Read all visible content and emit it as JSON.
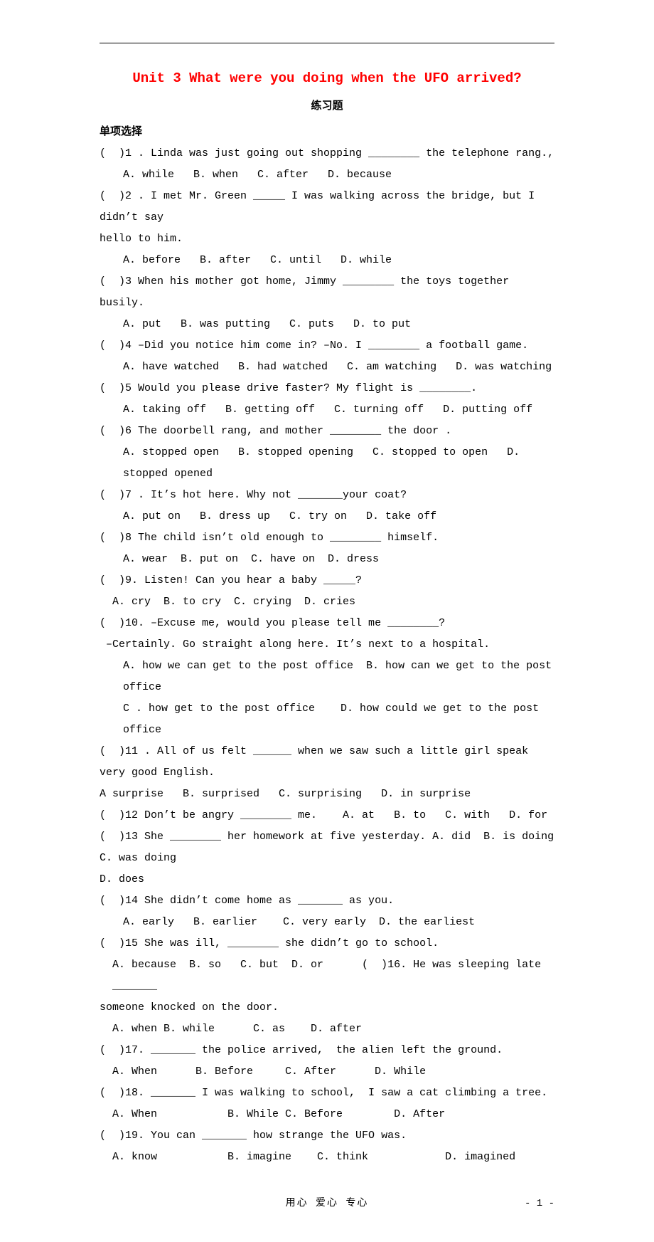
{
  "title": "Unit 3 What were you doing when the UFO arrived?",
  "subtitle": "练习题",
  "section": "单项选择",
  "lines": [
    {
      "cls": "q",
      "t": "(  )1 . Linda was just going out shopping ________ the telephone rang.,"
    },
    {
      "cls": "opt ind",
      "t": "A. while   B. when   C. after   D. because"
    },
    {
      "cls": "q",
      "t": "(  )2 . I met Mr. Green _____ I was walking across the bridge, but I didn’t say"
    },
    {
      "cls": "q",
      "t": "hello to him."
    },
    {
      "cls": "opt ind",
      "t": "A. before   B. after   C. until   D. while"
    },
    {
      "cls": "q",
      "t": "(  )3 When his mother got home, Jimmy ________ the toys together busily."
    },
    {
      "cls": "opt ind",
      "t": "A. put   B. was putting   C. puts   D. to put"
    },
    {
      "cls": "q",
      "t": "(  )4 –Did you notice him come in? –No. I ________ a football game."
    },
    {
      "cls": "opt ind",
      "t": "A. have watched   B. had watched   C. am watching   D. was watching"
    },
    {
      "cls": "q",
      "t": "(  )5 Would you please drive faster? My flight is ________."
    },
    {
      "cls": "opt ind",
      "t": "A. taking off   B. getting off   C. turning off   D. putting off"
    },
    {
      "cls": "q",
      "t": "(  )6 The doorbell rang, and mother ________ the door ."
    },
    {
      "cls": "opt ind",
      "t": "A. stopped open   B. stopped opening   C. stopped to open   D. stopped opened"
    },
    {
      "cls": "q",
      "t": "(  )7 . It’s hot here. Why not _______your coat?"
    },
    {
      "cls": "opt ind",
      "t": "A. put on   B. dress up   C. try on   D. take off"
    },
    {
      "cls": "q",
      "t": "(  )8 The child isn’t old enough to ________ himself."
    },
    {
      "cls": "opt ind",
      "t": "A. wear  B. put on  C. have on  D. dress"
    },
    {
      "cls": "q",
      "t": "(  )9. Listen! Can you hear a baby _____?"
    },
    {
      "cls": "opt ind1",
      "t": "A. cry  B. to cry  C. crying  D. cries"
    },
    {
      "cls": "q",
      "t": "(  )10. –Excuse me, would you please tell me ________?"
    },
    {
      "cls": "q",
      "t": " –Certainly. Go straight along here. It’s next to a hospital."
    },
    {
      "cls": "opt ind",
      "t": "A. how we can get to the post office  B. how can we get to the post office"
    },
    {
      "cls": "opt ind",
      "t": "C . how get to the post office    D. how could we get to the post office"
    },
    {
      "cls": "q",
      "t": "(  )11 . All of us felt ______ when we saw such a little girl speak very good English."
    },
    {
      "cls": "q",
      "t": "A surprise   B. surprised   C. surprising   D. in surprise"
    },
    {
      "cls": "q",
      "t": "(  )12 Don’t be angry ________ me.    A. at   B. to   C. with   D. for"
    },
    {
      "cls": "q",
      "t": "(  )13 She ________ her homework at five yesterday. A. did  B. is doing  C. was doing"
    },
    {
      "cls": "q",
      "t": "D. does"
    },
    {
      "cls": "q",
      "t": "(  )14 She didn’t come home as _______ as you."
    },
    {
      "cls": "opt ind",
      "t": "A. early   B. earlier    C. very early  D. the earliest"
    },
    {
      "cls": "q",
      "t": "(  )15 She was ill, ________ she didn’t go to school."
    },
    {
      "cls": "opt ind1",
      "t": "A. because  B. so   C. but  D. or      (  )16. He was sleeping late _______"
    },
    {
      "cls": "q",
      "t": "someone knocked on the door."
    },
    {
      "cls": "opt ind1",
      "t": "A. when B. while      C. as    D. after"
    },
    {
      "cls": "q",
      "t": "(  )17. _______ the police arrived,  the alien left the ground."
    },
    {
      "cls": "opt ind1",
      "t": "A. When      B. Before     C. After      D. While"
    },
    {
      "cls": "q",
      "t": "(  )18. _______ I was walking to school,  I saw a cat climbing a tree."
    },
    {
      "cls": "opt ind1",
      "t": "A. When           B. While C. Before        D. After"
    },
    {
      "cls": "q",
      "t": "(  )19. You can _______ how strange the UFO was."
    },
    {
      "cls": "opt ind1",
      "t": "A. know           B. imagine    C. think            D. imagined"
    }
  ],
  "footer": {
    "center": "用心    爱心    专心",
    "right": "- 1 -"
  }
}
